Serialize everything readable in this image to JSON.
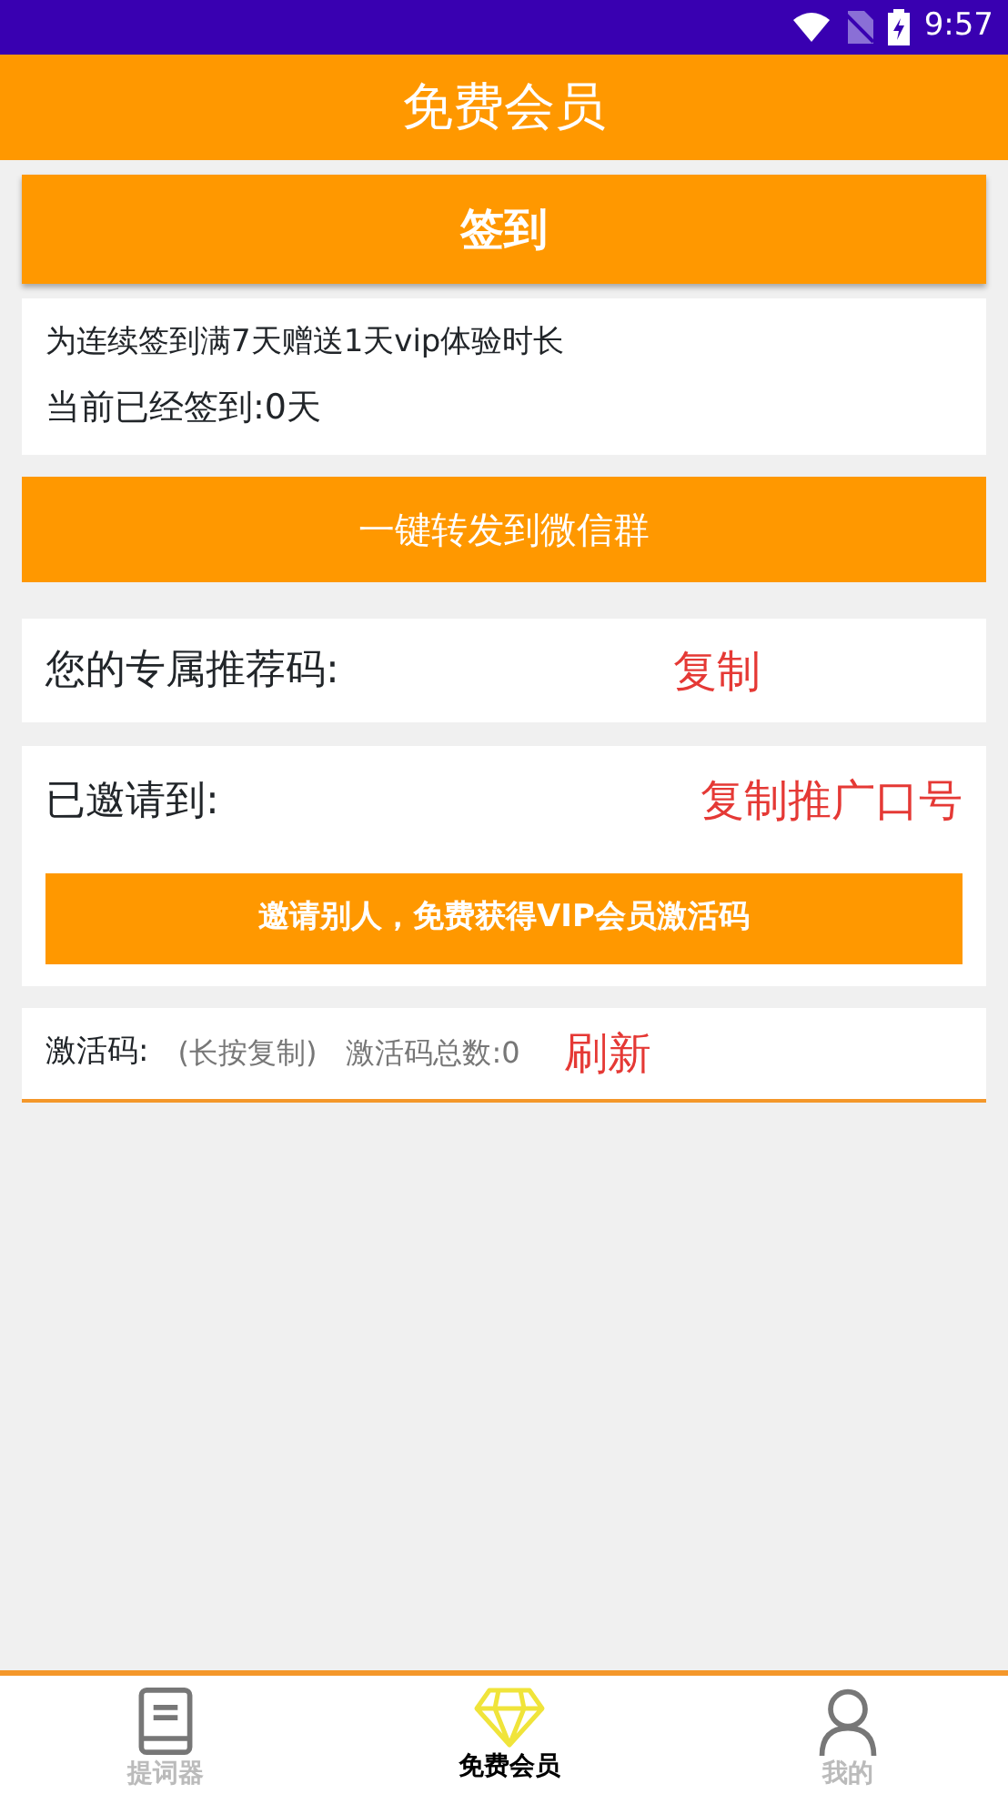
{
  "status_bar": {
    "time": "9:57"
  },
  "app_bar": {
    "title": "免费会员"
  },
  "sign_in_button": "签到",
  "sign_info": {
    "rule": "为连续签到满7天赠送1天vip体验时长",
    "current": "当前已经签到:0天"
  },
  "share_button": "一键转发到微信群",
  "referral": {
    "label": "您的专属推荐码:",
    "copy_link": "复制"
  },
  "invited": {
    "label": "已邀请到:",
    "copy_link": "复制推广口号",
    "invite_button": "邀请别人，免费获得VIP会员激活码"
  },
  "activation": {
    "label": "激活码:",
    "hint": "(长按复制)",
    "total": "激活码总数:0",
    "refresh_link": "刷新"
  },
  "bottom_nav": [
    {
      "kind": "book",
      "label": "提词器",
      "selected": false
    },
    {
      "kind": "diamond",
      "label": "免费会员",
      "selected": true
    },
    {
      "kind": "person",
      "label": "我的",
      "selected": false
    }
  ]
}
